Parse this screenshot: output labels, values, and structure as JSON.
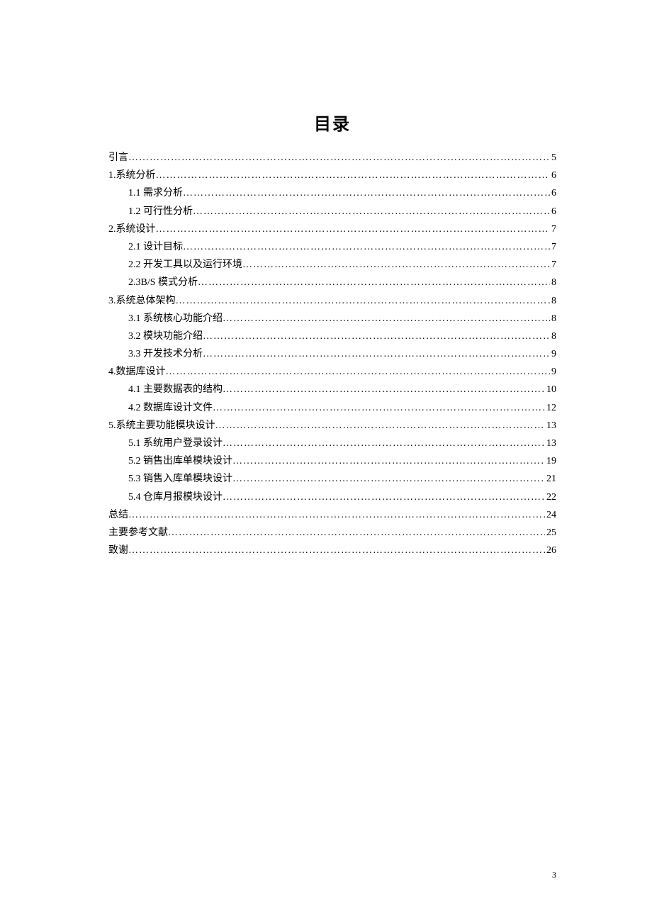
{
  "title": "目录",
  "page_number": "3",
  "toc": [
    {
      "level": 1,
      "label": "引言",
      "page": "5"
    },
    {
      "level": 1,
      "label": "1.系统分析",
      "page": "6"
    },
    {
      "level": 2,
      "label": "1.1 需求分析",
      "page": "6"
    },
    {
      "level": 2,
      "label": "1.2 可行性分析",
      "page": "6"
    },
    {
      "level": 1,
      "label": "2.系统设计",
      "page": "7"
    },
    {
      "level": 2,
      "label": "2.1 设计目标",
      "page": "7"
    },
    {
      "level": 2,
      "label": "2.2 开发工具以及运行环境",
      "page": "7"
    },
    {
      "level": 2,
      "label": "2.3B/S 模式分析",
      "page": "8"
    },
    {
      "level": 1,
      "label": "3.系统总体架构",
      "page": "8"
    },
    {
      "level": 2,
      "label": "3.1 系统核心功能介绍",
      "page": "8"
    },
    {
      "level": 2,
      "label": "3.2 模块功能介绍",
      "page": "8"
    },
    {
      "level": 2,
      "label": "3.3 开发技术分析",
      "page": "9"
    },
    {
      "level": 1,
      "label": "4.数据库设计",
      "page": "9"
    },
    {
      "level": 2,
      "label": "4.1 主要数据表的结构",
      "page": "10"
    },
    {
      "level": 2,
      "label": "4.2 数据库设计文件",
      "page": "12"
    },
    {
      "level": 1,
      "label": "5.系统主要功能模块设计",
      "page": "13"
    },
    {
      "level": 2,
      "label": "5.1 系统用户登录设计",
      "page": "13"
    },
    {
      "level": 2,
      "label": "5.2 销售出库单模块设计",
      "page": "19"
    },
    {
      "level": 2,
      "label": "5.3 销售入库单模块设计",
      "page": "21"
    },
    {
      "level": 2,
      "label": "5.4 仓库月报模块设计",
      "page": "22"
    },
    {
      "level": 1,
      "label": "总结",
      "page": "24"
    },
    {
      "level": 1,
      "label": "主要参考文献",
      "page": "25"
    },
    {
      "level": 1,
      "label": "致谢",
      "page": "26"
    }
  ]
}
